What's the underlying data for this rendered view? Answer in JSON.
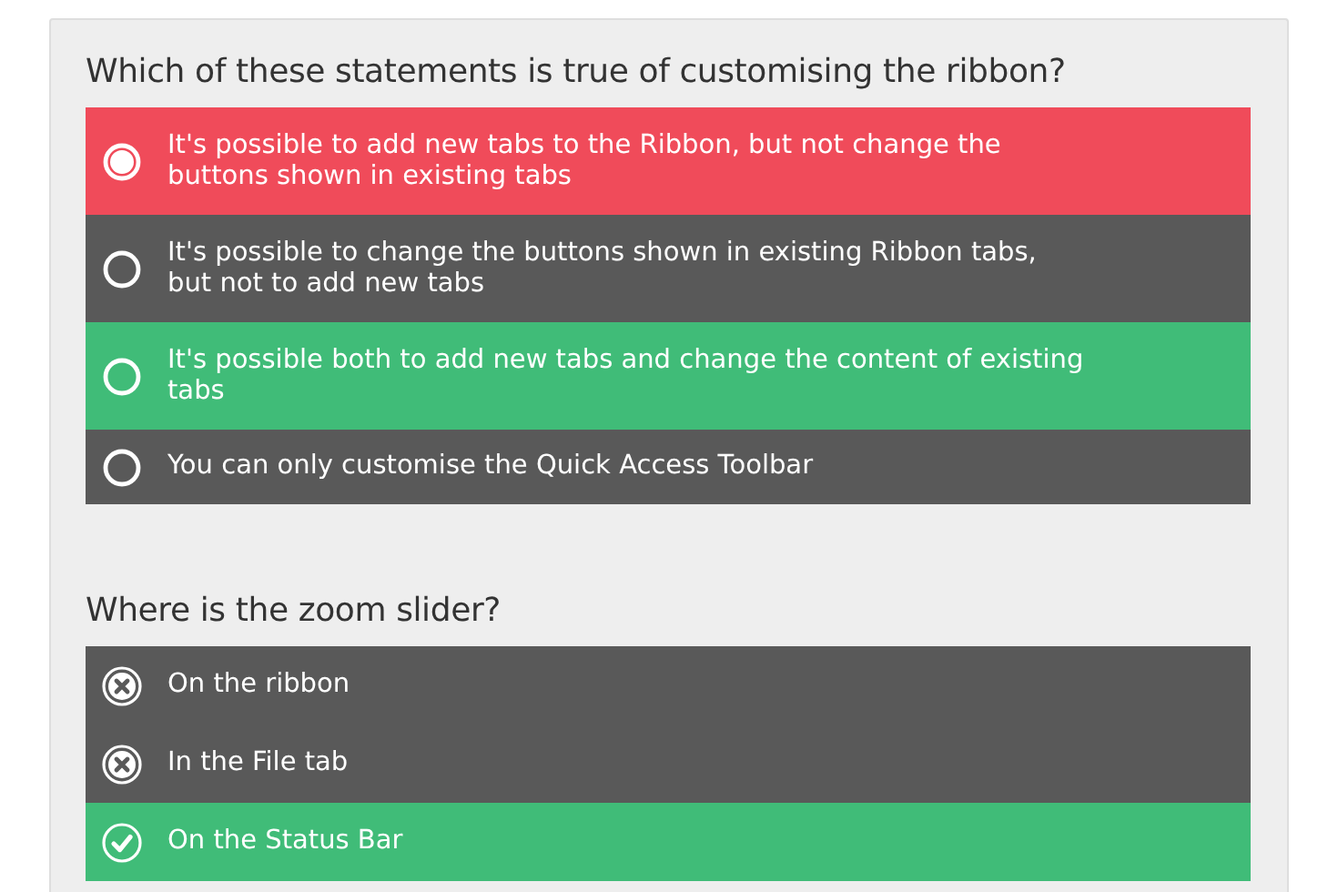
{
  "questions": [
    {
      "prompt": "Which of these statements is true of customising the ribbon?",
      "options": [
        {
          "text": "It's possible to add new tabs to the Ribbon, but not change the buttons shown in existing tabs",
          "color": "#f04b5a",
          "kind": "radio",
          "selected": true
        },
        {
          "text": "It's possible to change the buttons shown in existing Ribbon tabs, but not to add new tabs",
          "color": "#595959",
          "kind": "radio",
          "selected": false
        },
        {
          "text": "It's possible both to add new tabs and change the content of existing tabs",
          "color": "#40bc78",
          "kind": "radio",
          "selected": false
        },
        {
          "text": "You can only customise the Quick Access Toolbar",
          "color": "#595959",
          "kind": "radio",
          "selected": false
        }
      ]
    },
    {
      "prompt": "Where is the zoom slider?",
      "options": [
        {
          "text": "On the ribbon",
          "color": "#595959",
          "kind": "cross"
        },
        {
          "text": "In the File tab",
          "color": "#595959",
          "kind": "cross"
        },
        {
          "text": "On the Status Bar",
          "color": "#40bc78",
          "kind": "check"
        }
      ]
    }
  ]
}
